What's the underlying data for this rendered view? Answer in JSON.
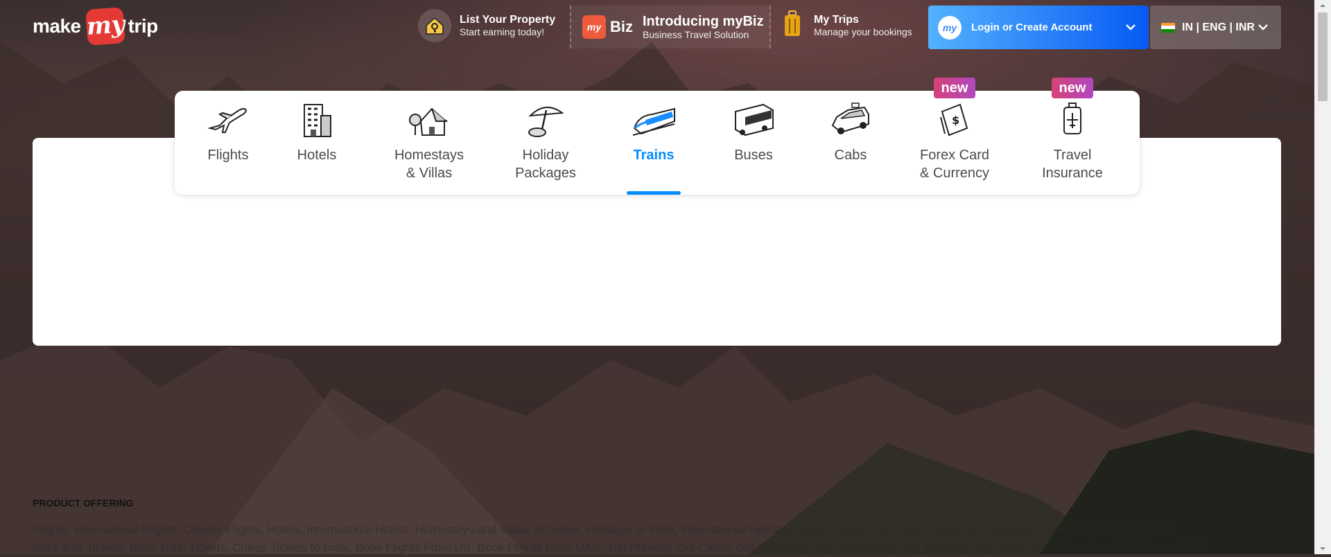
{
  "header": {
    "logo": {
      "make": "make",
      "my": "my",
      "trip": "trip"
    },
    "list_property": {
      "title": "List Your Property",
      "subtitle": "Start earning today!",
      "icon": "house-key-icon"
    },
    "mybiz": {
      "badge": "my",
      "badge_suffix": "Biz",
      "title": "Introducing myBiz",
      "subtitle": "Business Travel Solution"
    },
    "my_trips": {
      "title": "My Trips",
      "subtitle": "Manage your bookings",
      "icon": "suitcase-icon"
    },
    "login": {
      "avatar": "my",
      "label": "Login or Create Account",
      "accent_start": "#53b2fe",
      "accent_end": "#065af3"
    },
    "locale": {
      "label": "IN | ENG | INR"
    }
  },
  "tabs": [
    {
      "label": "Flights",
      "icon": "airplane-icon",
      "active": false
    },
    {
      "label": "Hotels",
      "icon": "hotel-building-icon",
      "active": false
    },
    {
      "label": "Homestays & Villas",
      "line1": "Homestays",
      "line2": "& Villas",
      "icon": "homestay-icon",
      "active": false
    },
    {
      "label": "Holiday Packages",
      "line1": "Holiday",
      "line2": "Packages",
      "icon": "beach-umbrella-icon",
      "active": false
    },
    {
      "label": "Trains",
      "icon": "train-icon",
      "active": true
    },
    {
      "label": "Buses",
      "icon": "bus-icon",
      "active": false
    },
    {
      "label": "Cabs",
      "icon": "cab-icon",
      "active": false
    },
    {
      "label": "Forex Card & Currency",
      "line1": "Forex Card",
      "line2": "& Currency",
      "icon": "forex-card-icon",
      "badge": "new",
      "active": false
    },
    {
      "label": "Travel Insurance",
      "line1": "Travel",
      "line2": "Insurance",
      "icon": "insurance-icon",
      "badge": "new",
      "active": false
    }
  ],
  "active_color": "#008cff",
  "product_offering": {
    "heading": "PRODUCT OFFERING",
    "line1": "Flights, International Flights, Charter Flights, Hotels, International Hotels, Homestays and Villas, Activities, Holidays In India, International Holidays, Book Hotels From UAE, myBiz for Corporate Travel, Book Online Cabs,",
    "line2": "Book Bus Tickets, Book Train Tickets, Cheap Tickets to India, Book Flights From US, Book Flights From UAE, Trip Planner, Gift Cards, Gift, Wedding Gift, Anniversary Gift, Birthday Gift, Diwali Gift, Valentines Gift, Farewell Gift,"
  }
}
